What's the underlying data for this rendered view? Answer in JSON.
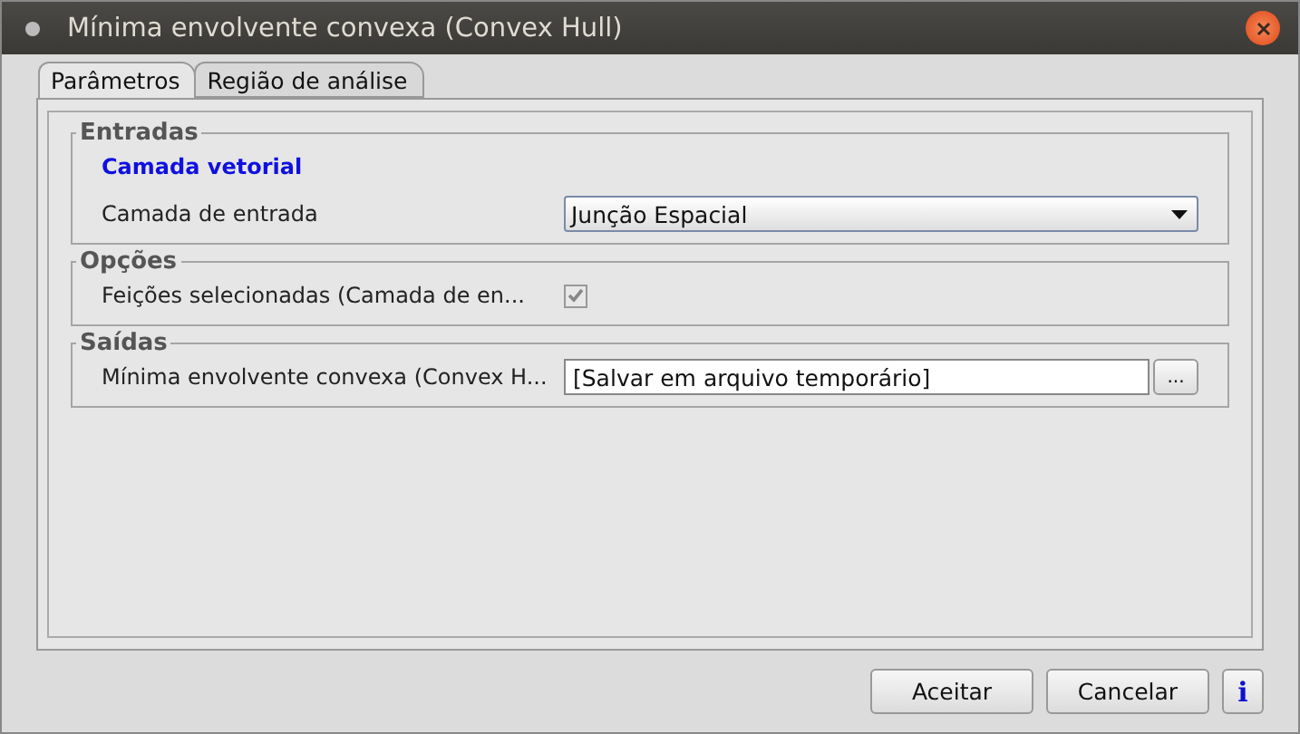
{
  "window": {
    "title": "Mínima envolvente convexa (Convex Hull)"
  },
  "tabs": [
    {
      "label": "Parâmetros",
      "selected": true
    },
    {
      "label": "Região de análise",
      "selected": false
    }
  ],
  "groups": [
    {
      "title": "Entradas",
      "rows": [
        {
          "kind": "heading",
          "label": "Camada vetorial"
        },
        {
          "kind": "select",
          "label": "Camada de entrada",
          "value": "Junção Espacial"
        }
      ]
    },
    {
      "title": "Opções",
      "rows": [
        {
          "kind": "checkbox",
          "label": "Feições selecionadas (Camada de en...",
          "checked": true,
          "disabled": true
        }
      ]
    },
    {
      "title": "Saídas",
      "rows": [
        {
          "kind": "file",
          "label": "Mínima envolvente convexa (Convex H...",
          "value": "[Salvar em arquivo temporário]",
          "button": "..."
        }
      ]
    }
  ],
  "buttons": [
    {
      "kind": "text",
      "label": "Aceitar"
    },
    {
      "kind": "text",
      "label": "Cancelar"
    },
    {
      "kind": "info",
      "label": "i"
    }
  ]
}
